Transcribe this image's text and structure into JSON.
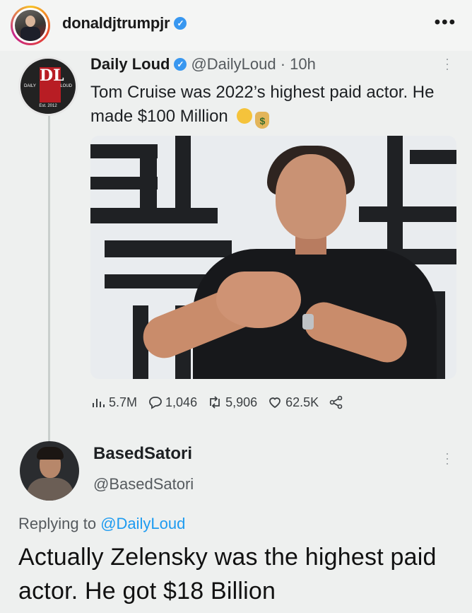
{
  "instagram": {
    "username": "donaldjtrumpjr",
    "verified": true,
    "more_label": "•••"
  },
  "tweet": {
    "author_name": "Daily Loud",
    "verified": true,
    "handle_time": "@DailyLoud · 10h",
    "text": "Tom Cruise was 2022’s highest paid actor. He made $100 Million",
    "emoji": [
      "exploding-head-emoji",
      "money-bag-emoji"
    ],
    "avatar_logo": {
      "letters": "DL",
      "left": "DAILY",
      "right": "LOUD",
      "est": "Est. 2012"
    },
    "stats": {
      "views": "5.7M",
      "replies": "1,046",
      "retweets": "5,906",
      "likes": "62.5K"
    }
  },
  "reply": {
    "author_name": "BasedSatori",
    "handle": "@BasedSatori",
    "replying_prefix": "Replying to",
    "replying_to": "@DailyLoud",
    "text": "Actually Zelensky was the highest paid actor. He got $18 Billion"
  },
  "colors": {
    "accent": "#1d9bf0",
    "verified": "#3897f0",
    "background": "#eef0ef"
  }
}
